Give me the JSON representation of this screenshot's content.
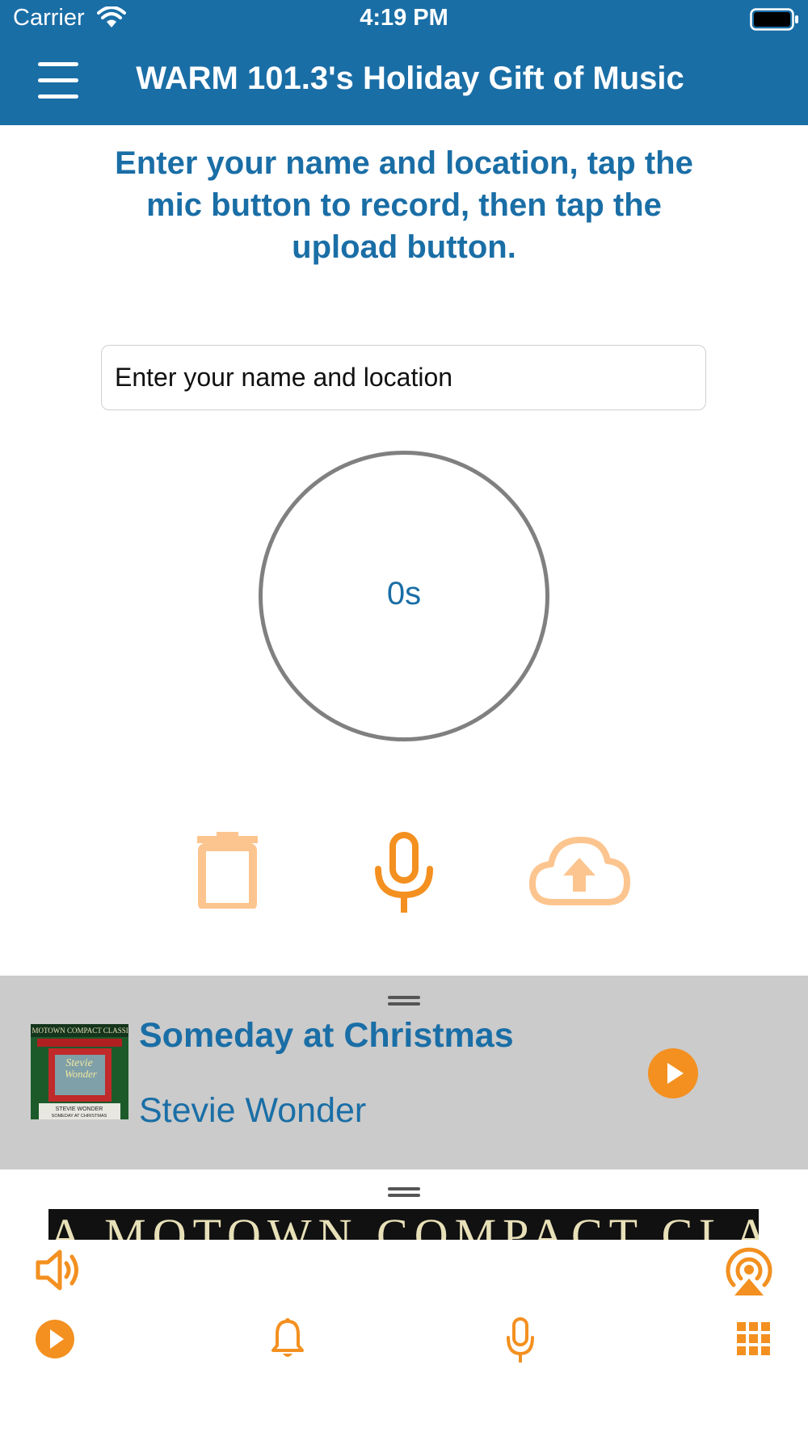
{
  "status_bar": {
    "carrier": "Carrier",
    "time": "4:19 PM"
  },
  "header": {
    "title": "WARM 101.3's Holiday Gift of Music"
  },
  "instructions": "Enter your name and location, tap the mic button to record, then tap the upload button.",
  "form": {
    "name_placeholder": "Enter your name and location"
  },
  "recorder": {
    "elapsed": "0s"
  },
  "actions": {
    "delete_icon": "trash-icon",
    "record_icon": "microphone-icon",
    "upload_icon": "cloud-upload-icon"
  },
  "now_playing": {
    "title": "Someday at Christmas",
    "artist": "Stevie Wonder"
  },
  "banner": {
    "text": "A MOTOWN COMPACT CLASSIC"
  },
  "album_art": {
    "top_text": "A MOTOWN COMPACT CLASSIC",
    "bottom_text": "STEVIE WONDER",
    "subtitle": "SOMEDAY AT CHRISTMAS"
  },
  "colors": {
    "brand_blue": "#1a6ea6",
    "accent_orange": "#f39020",
    "panel_gray": "#cbcbcb"
  },
  "toolbar": {
    "tabs": [
      "play-icon",
      "bell-icon",
      "microphone-icon",
      "grid-icon"
    ],
    "extras": [
      "volume-icon",
      "airplay-icon"
    ]
  }
}
